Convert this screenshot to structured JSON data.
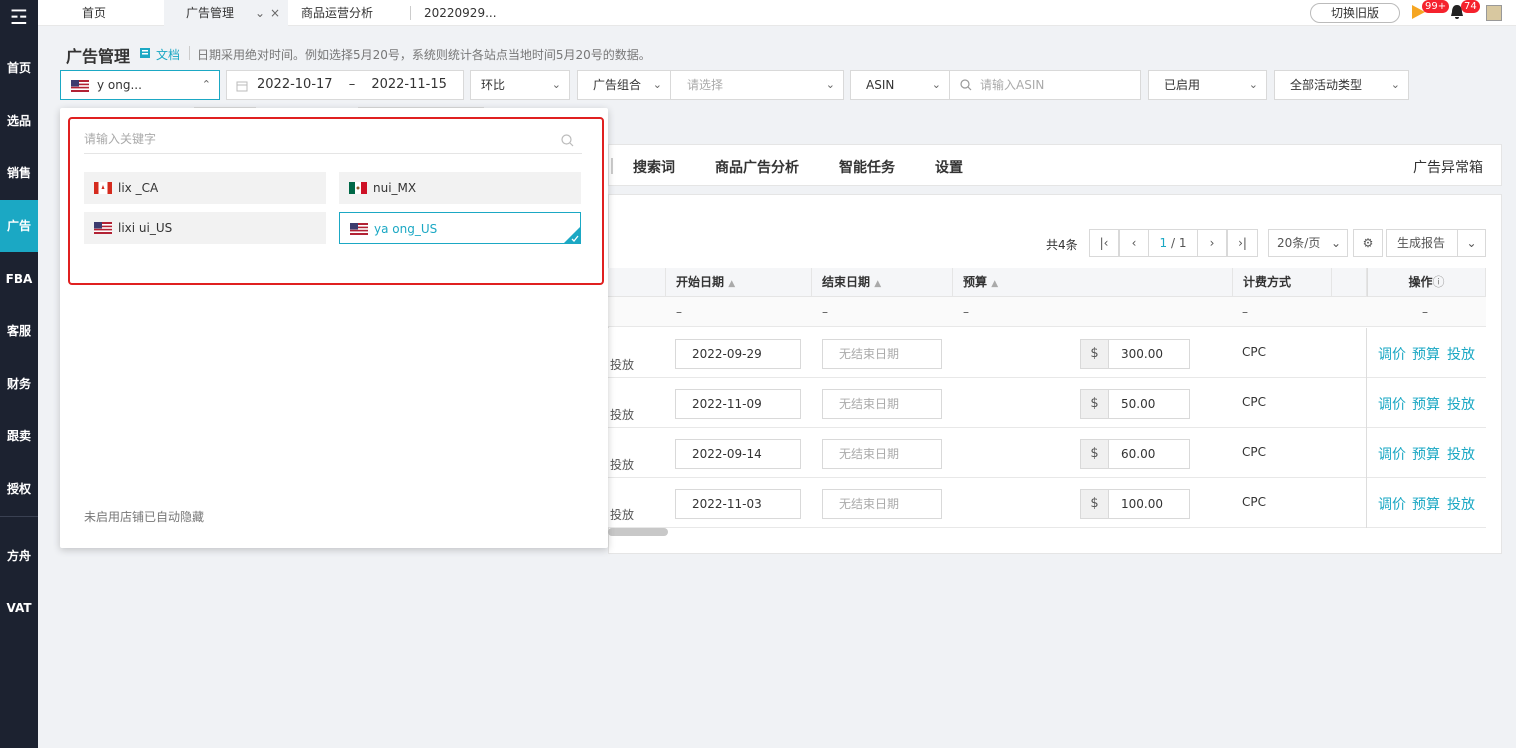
{
  "sidebar": {
    "logo": "☲",
    "items": [
      {
        "label": "首页"
      },
      {
        "label": "选品"
      },
      {
        "label": "销售"
      },
      {
        "label": "广告"
      },
      {
        "label": "FBA"
      },
      {
        "label": "客服"
      },
      {
        "label": "财务"
      },
      {
        "label": "跟卖"
      },
      {
        "label": "授权"
      },
      {
        "label": "方舟"
      },
      {
        "label": "VAT"
      }
    ]
  },
  "tabs": [
    {
      "label": "首页"
    },
    {
      "label": "广告管理"
    },
    {
      "label": "商品运营分析"
    },
    {
      "label": "20220929..."
    }
  ],
  "topbar": {
    "switch_old": "切换旧版",
    "badge1": "99+",
    "badge2": "74"
  },
  "header": {
    "title": "广告管理",
    "doc": "文档",
    "hint": "日期采用绝对时间。例如选择5月20号，系统则统计各站点当地时间5月20号的数据。"
  },
  "filters": {
    "store": "y       ong...",
    "date_start": "2022-10-17",
    "date_sep": "–",
    "date_end": "2022-11-15",
    "compare": "环比",
    "group_type": "广告组合",
    "group_ph": "请选择",
    "asin_type": "ASIN",
    "asin_ph": "请输入ASIN",
    "status": "已启用",
    "activity": "全部活动类型"
  },
  "dropdown": {
    "search_ph": "请输入关键字",
    "stores": [
      {
        "name": "lix        _CA",
        "flag": "CA"
      },
      {
        "name": "         nui_MX",
        "flag": "MX"
      },
      {
        "name": "lixi        ui_US",
        "flag": "US"
      },
      {
        "name": "ya             ong_US",
        "flag": "US",
        "selected": true
      }
    ],
    "footer": "未启用店铺已自动隐藏"
  },
  "subtabs": [
    {
      "label": "搜索词"
    },
    {
      "label": "商品广告分析"
    },
    {
      "label": "智能任务"
    },
    {
      "label": "设置"
    }
  ],
  "anomaly": "广告异常箱",
  "pager": {
    "total": "共4条",
    "current": "1",
    "pages": "/ 1",
    "per_page": "20条/页",
    "report": "生成报告"
  },
  "table": {
    "headers": {
      "start": "开始日期",
      "end": "结束日期",
      "budget": "预算",
      "billing": "计费方式",
      "ops": "操作"
    },
    "summary": {
      "dash": "–"
    },
    "rows": [
      {
        "target": "投放",
        "start": "2022-09-29",
        "end_ph": "无结束日期",
        "currency": "$",
        "budget": "300.00",
        "billing": "CPC"
      },
      {
        "target": "投放",
        "start": "2022-11-09",
        "end_ph": "无结束日期",
        "currency": "$",
        "budget": "50.00",
        "billing": "CPC"
      },
      {
        "target": "投放",
        "start": "2022-09-14",
        "end_ph": "无结束日期",
        "currency": "$",
        "budget": "60.00",
        "billing": "CPC"
      },
      {
        "target": "投放",
        "start": "2022-11-03",
        "end_ph": "无结束日期",
        "currency": "$",
        "budget": "100.00",
        "billing": "CPC"
      }
    ],
    "ops": {
      "bid": "调价",
      "budget": "预算",
      "target": "投放"
    }
  },
  "colors": {
    "accent": "#1ba8c4",
    "sidebar": "#1c2230",
    "highlight": "#e02020"
  }
}
